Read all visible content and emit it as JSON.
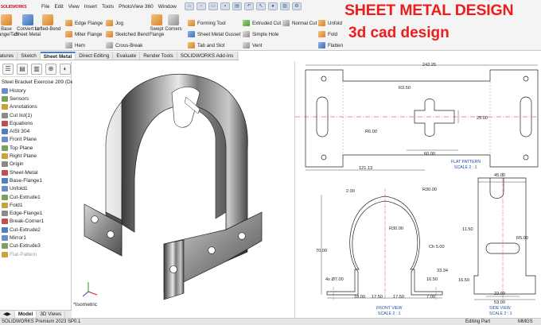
{
  "app": {
    "logo_text": "SOLIDWORKS",
    "menus": [
      "File",
      "Edit",
      "View",
      "Insert",
      "Tools",
      "PhotoView 360",
      "Window"
    ]
  },
  "ribbon": {
    "base_flange": "Base Flange/Tab",
    "convert": "Convert to Sheet Metal",
    "lofted_bend": "Lofted-Bend",
    "edge_flange": "Edge Flange",
    "miter_flange": "Miter Flange",
    "hem": "Hem",
    "jog": "Jog",
    "sketched_bend": "Sketched Bend",
    "cross_break": "Cross-Break",
    "swept_flange": "Swept Flange",
    "corners": "Corners",
    "forming_tool": "Forming Tool",
    "sheet_metal_gusset": "Sheet Metal Gusset",
    "tab_and_slot": "Tab and Slot",
    "extruded_cut": "Extruded Cut",
    "simple_hole": "Simple Hole",
    "vent": "Vent",
    "normal_cut": "Normal Cut",
    "unfold": "Unfold",
    "fold": "Fold",
    "flatten": "Flatten"
  },
  "command_tabs": [
    {
      "label": "Features",
      "active": false
    },
    {
      "label": "Sketch",
      "active": false
    },
    {
      "label": "Sheet Metal",
      "active": true
    },
    {
      "label": "Direct Editing",
      "active": false
    },
    {
      "label": "Evaluate",
      "active": false
    },
    {
      "label": "Render Tools",
      "active": false
    },
    {
      "label": "SOLIDWORKS Add-Ins",
      "active": false
    }
  ],
  "feature_tree": {
    "root": "Steel Bracket Exercise 209 (Default)",
    "items": [
      {
        "label": "History",
        "dim": false
      },
      {
        "label": "Sensors",
        "dim": false
      },
      {
        "label": "Annotations",
        "dim": false
      },
      {
        "label": "Cut list(1)",
        "dim": false
      },
      {
        "label": "Equations",
        "dim": false
      },
      {
        "label": "AISI 304",
        "dim": false
      },
      {
        "label": "Front Plane",
        "dim": false
      },
      {
        "label": "Top Plane",
        "dim": false
      },
      {
        "label": "Right Plane",
        "dim": false
      },
      {
        "label": "Origin",
        "dim": false
      },
      {
        "label": "Sheet-Metal",
        "dim": false
      },
      {
        "label": "Base-Flange1",
        "dim": false
      },
      {
        "label": "Unfold1",
        "dim": false
      },
      {
        "label": "Cut-Extrude1",
        "dim": false
      },
      {
        "label": "Fold1",
        "dim": false
      },
      {
        "label": "Edge-Flange1",
        "dim": false
      },
      {
        "label": "Break-Corner1",
        "dim": false
      },
      {
        "label": "Cut-Extrude2",
        "dim": false
      },
      {
        "label": "Mirror1",
        "dim": false
      },
      {
        "label": "Cut-Extrude3",
        "dim": false
      },
      {
        "label": "Flat-Pattern",
        "dim": true
      }
    ]
  },
  "model_tabs": [
    "Model",
    "3D Views"
  ],
  "view_label": "*Isometric",
  "status": {
    "left": "SOLIDWORKS Premium 2023 SP0.1",
    "middle": "Editing Part",
    "right": "MMGS"
  },
  "headline": "SHEET METAL DESIGN",
  "subline": "3d cad design",
  "drawing": {
    "flat_pattern": {
      "dims": {
        "overall_width": "242.25",
        "r3": "R3.50",
        "r6": "R6.00",
        "height": "25.00",
        "slot_width": "60.00",
        "left_offset": "121.13"
      },
      "title": "FLAT PATTERN",
      "scale": "SCALE 2 : 1"
    },
    "front_view": {
      "dims": {
        "thickness": "2.00",
        "r_outer": "R30.00",
        "r_inner": "R30.00",
        "height": "70.00",
        "chamfer": "Ch 5.00",
        "d1": "33.34",
        "d2": "16.50",
        "holes": "4x Ø7.00",
        "b1": "18.00",
        "b2": "17.50",
        "b3": "17.50",
        "b4": "7.00"
      },
      "title": "FRONT VIEW",
      "scale": "SCALE 2 : 1"
    },
    "side_view": {
      "dims": {
        "top": "45.00",
        "h1": "11.50",
        "r5": "R5.00",
        "h2": "16.50",
        "w1": "22.00",
        "w2": "53.00"
      },
      "title": "SIDE VIEW",
      "scale": "SCALE 2 : 1"
    }
  }
}
